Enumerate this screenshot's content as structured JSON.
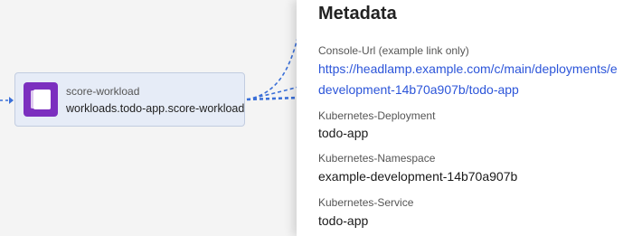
{
  "node": {
    "title": "score-workload",
    "subtitle": "workloads.todo-app.score-workload",
    "icon": "score-logo-icon"
  },
  "panel": {
    "title": "Metadata",
    "fields": [
      {
        "label": "Console-Url (example link only)",
        "value_line1": "https://headlamp.example.com/c/main/deployments/e",
        "value_line2": "development-14b70a907b/todo-app",
        "is_link": true
      },
      {
        "label": "Kubernetes-Deployment",
        "value": "todo-app"
      },
      {
        "label": "Kubernetes-Namespace",
        "value": "example-development-14b70a907b"
      },
      {
        "label": "Kubernetes-Service",
        "value": "todo-app"
      }
    ]
  },
  "colors": {
    "edge": "#3a6fd8",
    "link": "#2c55d9",
    "icon_bg": "#7b2fbf",
    "node_bg": "#e6ecf7"
  }
}
